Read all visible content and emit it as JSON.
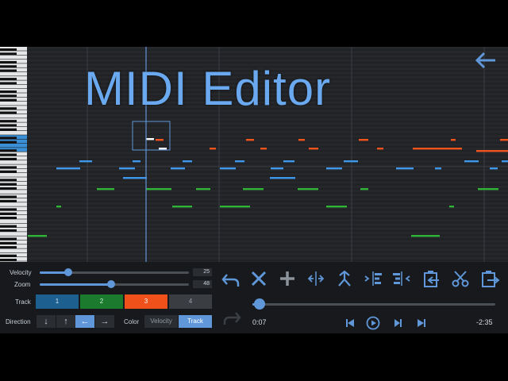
{
  "title": "MIDI Editor",
  "colors": {
    "accent": "#5f97d8",
    "track1": "#1d5f8e",
    "track2": "#1b7a2e",
    "track3": "#f0501a",
    "track4": "#3a3d42",
    "note_blue": "#3e97e8",
    "note_orange": "#f0541e",
    "note_green": "#2fb437"
  },
  "icons": {
    "back": "arrow-left-icon",
    "undo": "undo-icon",
    "delete": "x-icon",
    "add": "plus-icon",
    "stretch": "expand-horizontal-icon",
    "merge": "merge-icon",
    "align_left": "align-left-icon",
    "align_right": "align-right-icon",
    "paste": "clipboard-paste-icon",
    "cut": "scissors-icon",
    "copy": "clipboard-copy-icon",
    "redo": "redo-icon",
    "skip_back": "skip-back-icon",
    "play": "play-icon",
    "step_forward": "step-forward-icon",
    "skip_forward": "skip-forward-icon"
  },
  "controls": {
    "velocity_label": "Velocity",
    "velocity_value": "25",
    "velocity_level": 0.19,
    "zoom_label": "Zoom",
    "zoom_value": "48",
    "zoom_level": 0.48,
    "track_label": "Track",
    "tracks": [
      "1",
      "2",
      "3",
      "4"
    ],
    "selected_track": "3",
    "direction_label": "Direction",
    "direction_buttons": [
      "↓",
      "↑",
      "←",
      "→"
    ],
    "selected_direction": "←",
    "color_label": "Color",
    "color_options": [
      "Velocity",
      "Track"
    ],
    "selected_color": "Track"
  },
  "playback": {
    "elapsed": "0:07",
    "remaining": "-2:35",
    "progress": 0.03
  }
}
